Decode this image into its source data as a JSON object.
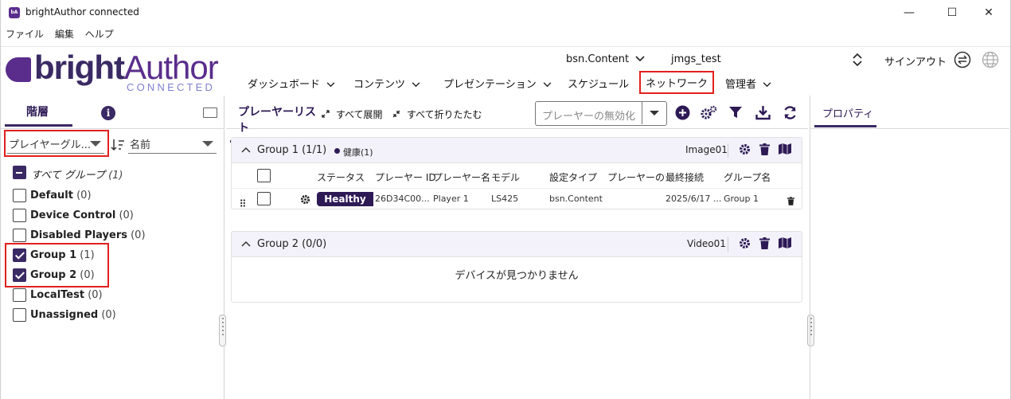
{
  "window": {
    "icon_text": "bA",
    "title": "brightAuthor connected",
    "controls": [
      "—",
      "☐",
      "✕"
    ]
  },
  "menu": [
    "ファイル",
    "編集",
    "ヘルプ"
  ],
  "logo": {
    "bright": "bright",
    "author": "Author",
    "sub": "CONNECTED"
  },
  "header": {
    "content_selector": "bsn.Content",
    "user": "jmgs_test",
    "signout": "サインアウト",
    "nav": [
      "ダッシュボード",
      "コンテンツ",
      "プレゼンテーション",
      "スケジュール",
      "ネットワーク",
      "管理者"
    ]
  },
  "left": {
    "tab": "階層",
    "info_glyph": "i",
    "filter_value": "プレイヤーグル...",
    "sort_value": "名前",
    "all_groups_label": "すべて グループ",
    "all_groups_count": "(1)",
    "groups": [
      {
        "name": "Default",
        "count": "(0)",
        "checked": false
      },
      {
        "name": "Device Control",
        "count": "(0)",
        "checked": false
      },
      {
        "name": "Disabled Players",
        "count": "(0)",
        "checked": false
      },
      {
        "name": "Group 1",
        "count": "(1)",
        "checked": true
      },
      {
        "name": "Group 2",
        "count": "(0)",
        "checked": true
      },
      {
        "name": "LocalTest",
        "count": "(0)",
        "checked": false
      },
      {
        "name": "Unassigned",
        "count": "(0)",
        "checked": false
      }
    ]
  },
  "center": {
    "tab": "プレーヤーリスト",
    "expand_all": "すべて展開",
    "collapse_all": "すべて折りたたむ",
    "disable_placeholder": "プレーヤーの無効化",
    "group1": {
      "title": "Group 1  (1/1)",
      "health_label": "健康(1)",
      "template": "Image01",
      "columns": [
        "ステータス",
        "プレーヤー ID",
        "プレーヤー名",
        "モデル",
        "設定タイプ",
        "プレーヤーの説明",
        "最終接続",
        "グループ名"
      ],
      "row": {
        "status": "Healthy",
        "player_id": "26D34C00...",
        "player_name": "Player 1",
        "model": "LS425",
        "setup_type": "bsn.Content",
        "last_connected": "2025/6/17 ...",
        "group_name": "Group 1"
      }
    },
    "group2": {
      "title": "Group 2  (0/0)",
      "template": "Video01",
      "empty_message": "デバイスが見つかりません"
    }
  },
  "right": {
    "tab": "プロパティ"
  },
  "colors": {
    "brand": "#3a2a64",
    "accent": "#5a2d8c",
    "highlight": "#e1201d"
  }
}
